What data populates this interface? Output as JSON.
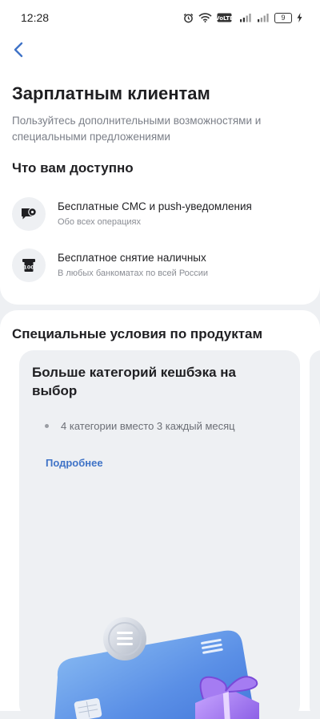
{
  "status_bar": {
    "time": "12:28",
    "network_badge": "VoLTE",
    "battery_level": "9"
  },
  "header": {
    "title": "Зарплатным клиентам",
    "subtitle": "Пользуйтесь дополнительными возможностями и специальными предложениями"
  },
  "benefits": {
    "heading": "Что вам доступно",
    "items": [
      {
        "title": "Бесплатные СМС и push-уведомления",
        "description": "Обо всех операциях",
        "icon": "bell-message-icon"
      },
      {
        "title": "Бесплатное снятие наличных",
        "description": "В любых банкоматах по всей России",
        "icon": "atm-cash-icon"
      }
    ]
  },
  "products": {
    "heading": "Специальные условия по продуктам",
    "card": {
      "title": "Больше категорий кешбэка на выбор",
      "bullet": "4 категории вместо 3 каждый месяц",
      "link": "Подробнее"
    }
  },
  "colors": {
    "accent": "#3f73c7",
    "background": "#eef0f3",
    "card": "#ffffff"
  }
}
